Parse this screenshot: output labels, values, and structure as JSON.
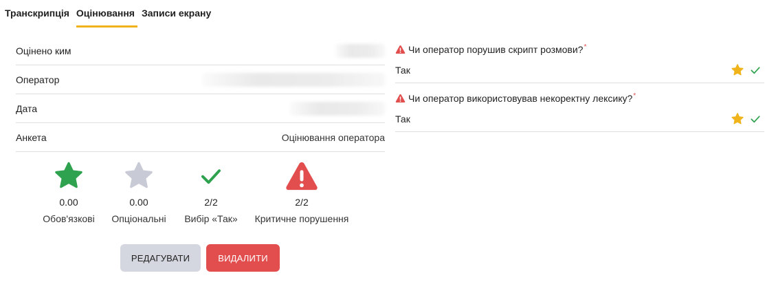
{
  "tabs": [
    {
      "label": "Транскрипція"
    },
    {
      "label": "Оцінювання"
    },
    {
      "label": "Записи екрану"
    }
  ],
  "info": {
    "rows": [
      {
        "label": "Оцінено ким",
        "value": ""
      },
      {
        "label": "Оператор",
        "value": ""
      },
      {
        "label": "Дата",
        "value": ""
      },
      {
        "label": "Анкета",
        "value": "Оцінювання оператора"
      }
    ]
  },
  "stats": [
    {
      "icon": "star-filled-icon",
      "color": "#2ea24e",
      "value": "0.00",
      "label": "Обов'язкові"
    },
    {
      "icon": "star-filled-icon",
      "color": "#c8cad6",
      "value": "0.00",
      "label": "Опціональні"
    },
    {
      "icon": "check-icon",
      "color": "#2ea24e",
      "value": "2/2",
      "label": "Вибір «Так»"
    },
    {
      "icon": "warning-icon",
      "color": "#e24e4e",
      "value": "2/2",
      "label": "Критичне порушення"
    }
  ],
  "buttons": {
    "edit_label": "РЕДАГУВАТИ",
    "delete_label": "ВИДАЛИТИ"
  },
  "questions": [
    {
      "title": "Чи оператор порушив скрипт розмови?",
      "required_mark": "*",
      "answer": "Так"
    },
    {
      "title": "Чи оператор використовував некоректну лексику?",
      "required_mark": "*",
      "answer": "Так"
    }
  ],
  "colors": {
    "accent": "#f0b41a",
    "success": "#2ea24e",
    "danger": "#e24e4e",
    "muted": "#c8cad6"
  }
}
